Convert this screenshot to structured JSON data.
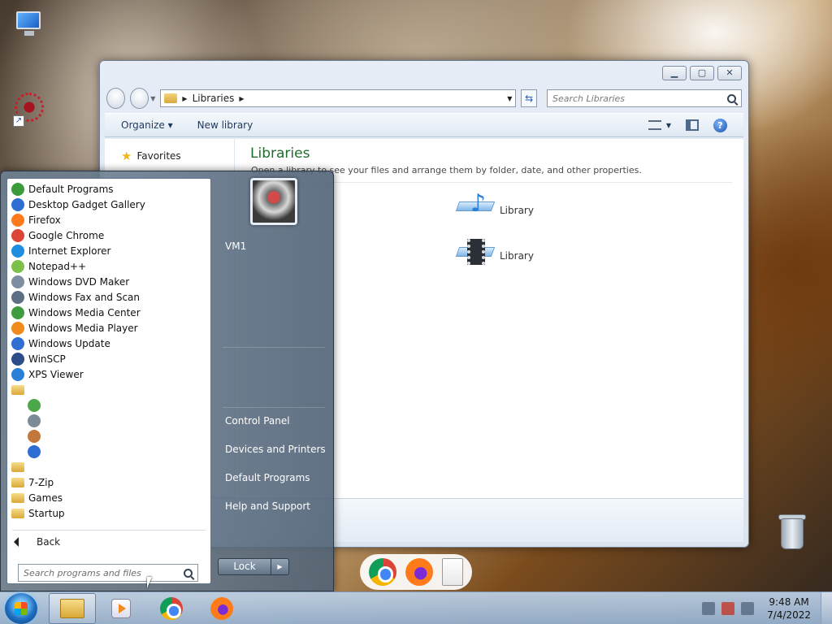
{
  "explorer": {
    "address": {
      "crumb": "Libraries"
    },
    "search": {
      "placeholder": "Search Libraries"
    },
    "toolbar": {
      "organize": "Organize ▾",
      "new_library": "New library"
    },
    "nav": {
      "favorites": "Favorites"
    },
    "content": {
      "title": "Libraries",
      "subtitle": "Open a library to see your files and arrange them by folder, date, and other properties.",
      "items": [
        {
          "label": "Library",
          "icon": "music-library-icon"
        },
        {
          "label": "Library",
          "icon": "videos-library-icon"
        }
      ]
    }
  },
  "start_menu": {
    "programs": [
      {
        "label": "Default Programs",
        "icon": "default-programs-icon",
        "color": "#3a9b3a"
      },
      {
        "label": "Desktop Gadget Gallery",
        "icon": "gadget-gallery-icon",
        "color": "#2f6fd3"
      },
      {
        "label": "Firefox",
        "icon": "firefox-icon",
        "color": "#ff7a1a"
      },
      {
        "label": "Google Chrome",
        "icon": "chrome-icon",
        "color": "#db4437"
      },
      {
        "label": "Internet Explorer",
        "icon": "internet-explorer-icon",
        "color": "#1f8de0"
      },
      {
        "label": "Notepad++",
        "icon": "notepad-plus-icon",
        "color": "#7cc04a"
      },
      {
        "label": "Windows DVD Maker",
        "icon": "dvd-maker-icon",
        "color": "#7d8ea3"
      },
      {
        "label": "Windows Fax and Scan",
        "icon": "fax-scan-icon",
        "color": "#5d6f84"
      },
      {
        "label": "Windows Media Center",
        "icon": "media-center-icon",
        "color": "#3f9b3f"
      },
      {
        "label": "Windows Media Player",
        "icon": "media-player-icon",
        "color": "#f08a1c"
      },
      {
        "label": "Windows Update",
        "icon": "windows-update-icon",
        "color": "#2f6fd3"
      },
      {
        "label": "WinSCP",
        "icon": "winscp-icon",
        "color": "#2c4d8a"
      },
      {
        "label": "XPS Viewer",
        "icon": "xps-viewer-icon",
        "color": "#2a7fd6"
      }
    ],
    "sub_icons": [
      "accessories-folder-icon",
      "green-arrows-icon",
      "usb-device-icon",
      "user-accounts-icon",
      "help-circle-icon"
    ],
    "folders": [
      {
        "label": "",
        "icon": "folder-icon"
      },
      {
        "label": "7-Zip",
        "icon": "folder-icon"
      },
      {
        "label": "Games",
        "icon": "folder-icon"
      },
      {
        "label": "Startup",
        "icon": "folder-icon"
      }
    ],
    "back_label": "Back",
    "search_placeholder": "Search programs and files",
    "user_name": "VM1",
    "right_items": [
      "Control Panel",
      "Devices and Printers",
      "Default Programs",
      "Help and Support"
    ],
    "lock_label": "Lock"
  },
  "taskbar": {
    "time": "9:48 AM",
    "date": "7/4/2022"
  }
}
